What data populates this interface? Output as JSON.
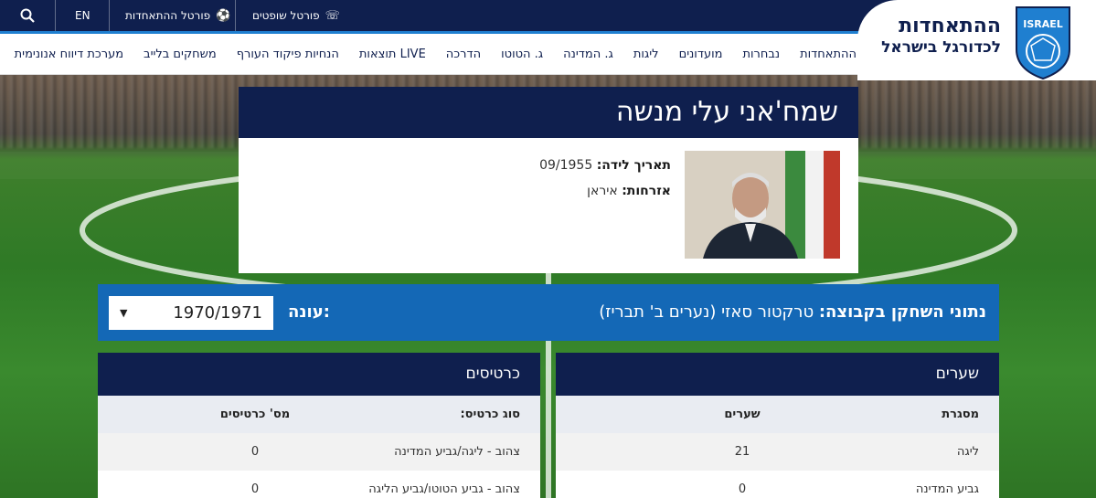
{
  "topbar": {
    "lang": "EN",
    "federation_portal": "פורטל ההתאחדות",
    "referee_portal": "פורטל שופטים"
  },
  "logo": {
    "line1": "ההתאחדות",
    "line2": "לכדורגל בישראל",
    "badge_text": "ISRAEL"
  },
  "nav": {
    "items": [
      "ההתאחדות",
      "נבחרות",
      "מועדונים",
      "ליגות",
      "ג. המדינה",
      "ג. הטוטו",
      "הדרכה",
      "תוצאות LIVE",
      "הנחיות פיקוד העורף",
      "משחקים בלייב",
      "מערכת דיווח אנונימית"
    ]
  },
  "player": {
    "name": "שמח'אני עלי מנשה",
    "birth_label": "תאריך לידה:",
    "birth_value": "09/1955",
    "citizenship_label": "אזרחות:",
    "citizenship_value": "איראן"
  },
  "season": {
    "team_label": "נתוני השחקן בקבוצה:",
    "team_value": "טרקטור סאזי (נערים ב' תבריז)",
    "season_label": "עונה:",
    "selected": "1970/1971"
  },
  "goals_table": {
    "title": "שערים",
    "col_framework": "מסגרת",
    "col_goals": "שערים",
    "rows": [
      {
        "framework": "ליגה",
        "goals": "21"
      },
      {
        "framework": "גביע המדינה",
        "goals": "0"
      }
    ]
  },
  "cards_table": {
    "title": "כרטיסים",
    "col_type": "סוג כרטיס:",
    "col_count": "מס' כרטיסים",
    "rows": [
      {
        "type": "צהוב - ליגה/גביע המדינה",
        "count": "0"
      },
      {
        "type": "צהוב - גביע הטוטו/גביע הליגה",
        "count": "0"
      }
    ]
  },
  "colors": {
    "navy": "#0f1f4e",
    "blue": "#1468b6",
    "accent": "#1f7fd0"
  }
}
